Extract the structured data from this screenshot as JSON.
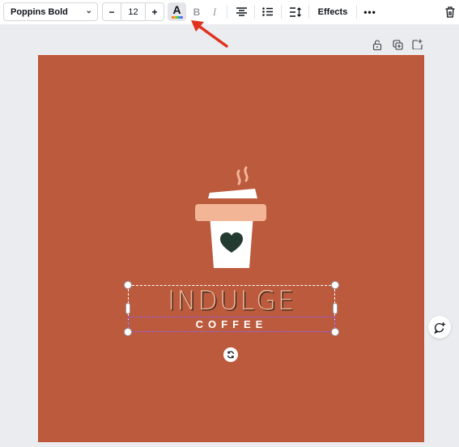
{
  "toolbar": {
    "font_family": "Poppins Bold",
    "font_size": "12",
    "decrease_label": "−",
    "increase_label": "+",
    "text_color_label": "A",
    "bold_label": "B",
    "italic_label": "I",
    "effects_label": "Effects",
    "more_label": "•••",
    "icons": [
      "text-color-icon",
      "bold-icon",
      "italic-icon",
      "align-center-icon",
      "list-icon",
      "spacing-icon",
      "more-icon",
      "trash-icon"
    ]
  },
  "canvas_actions": {
    "icons": [
      "lock-icon",
      "duplicate-icon",
      "add-page-icon"
    ]
  },
  "design": {
    "background_color": "#bb5a3d",
    "headline": "INDULGE",
    "subline": "COFFEE",
    "headline_color": "#f2b596",
    "subline_color": "#ffffff",
    "cup_sleeve_color": "#f2b596",
    "heart_color": "#233a31"
  },
  "selection": {
    "box_color": "#ffffff",
    "subselection_color": "#8b5cf6"
  },
  "annotation": {
    "arrow_color": "#e0321f",
    "points_to": "text-color-button"
  }
}
